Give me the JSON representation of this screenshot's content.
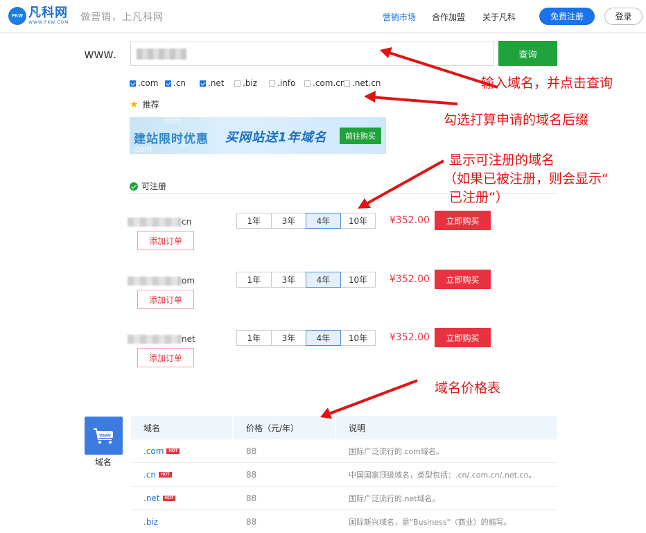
{
  "header": {
    "logo_mark": "FKW",
    "logo_name": "凡科网",
    "logo_url": "WWW.FKW.COM",
    "slogan": "做营销，上凡科网",
    "nav": [
      "营销市场",
      "合作加盟",
      "关于凡科"
    ],
    "register_label": "免费注册",
    "login_label": "登录",
    "accent": "#1a73e8"
  },
  "search": {
    "prefix": "www.",
    "value": "",
    "button_label": "查询"
  },
  "suffixes": [
    {
      "label": ".com",
      "checked": true
    },
    {
      "label": ".cn",
      "checked": true
    },
    {
      "label": ".net",
      "checked": true
    },
    {
      "label": ".biz",
      "checked": false
    },
    {
      "label": ".info",
      "checked": false
    },
    {
      "label": ".com.cn",
      "checked": false
    },
    {
      "label": ".net.cn",
      "checked": false
    }
  ],
  "recommend_label": "推荐",
  "banner": {
    "left_text": "建站限时优惠",
    "mid_text": "买网站送1年域名",
    "button_label": "前往购买"
  },
  "available": {
    "heading": "可注册",
    "add_label": "添加订单",
    "buy_label": "立即购买",
    "years": [
      "1年",
      "3年",
      "4年",
      "10年"
    ],
    "selected_year": "4年",
    "rows": [
      {
        "suffix": "cn",
        "price": "¥352.00"
      },
      {
        "suffix": "om",
        "price": "¥352.00"
      },
      {
        "suffix": "net",
        "price": "¥352.00"
      }
    ]
  },
  "price_table": {
    "category_label": "域名",
    "icon_text": "www",
    "headers": [
      "域名",
      "价格（元/年）",
      "说明"
    ],
    "hot_label": "HOT",
    "rows": [
      {
        "domain": ".com",
        "price": "88",
        "desc": "国际广泛流行的.com域名。",
        "hot": true
      },
      {
        "domain": ".cn",
        "price": "88",
        "desc": "中国国家顶级域名，类型包括：.cn/.com.cn/.net.cn。",
        "hot": true
      },
      {
        "domain": ".net",
        "price": "88",
        "desc": "国际广泛流行的.net域名。",
        "hot": true
      },
      {
        "domain": ".biz",
        "price": "88",
        "desc": "国际新兴域名，是\"Business\"（商业）的缩写。",
        "hot": false
      }
    ]
  },
  "annotations": {
    "a1": "输入域名，并点击查询",
    "a2": "勾选打算申请的域名后缀",
    "a3_line1": "显示可注册的域名",
    "a3_line2": "（如果已被注册，则会显示“",
    "a3_line3": "已注册”）",
    "a4": "域名价格表",
    "color": "#e01414"
  }
}
